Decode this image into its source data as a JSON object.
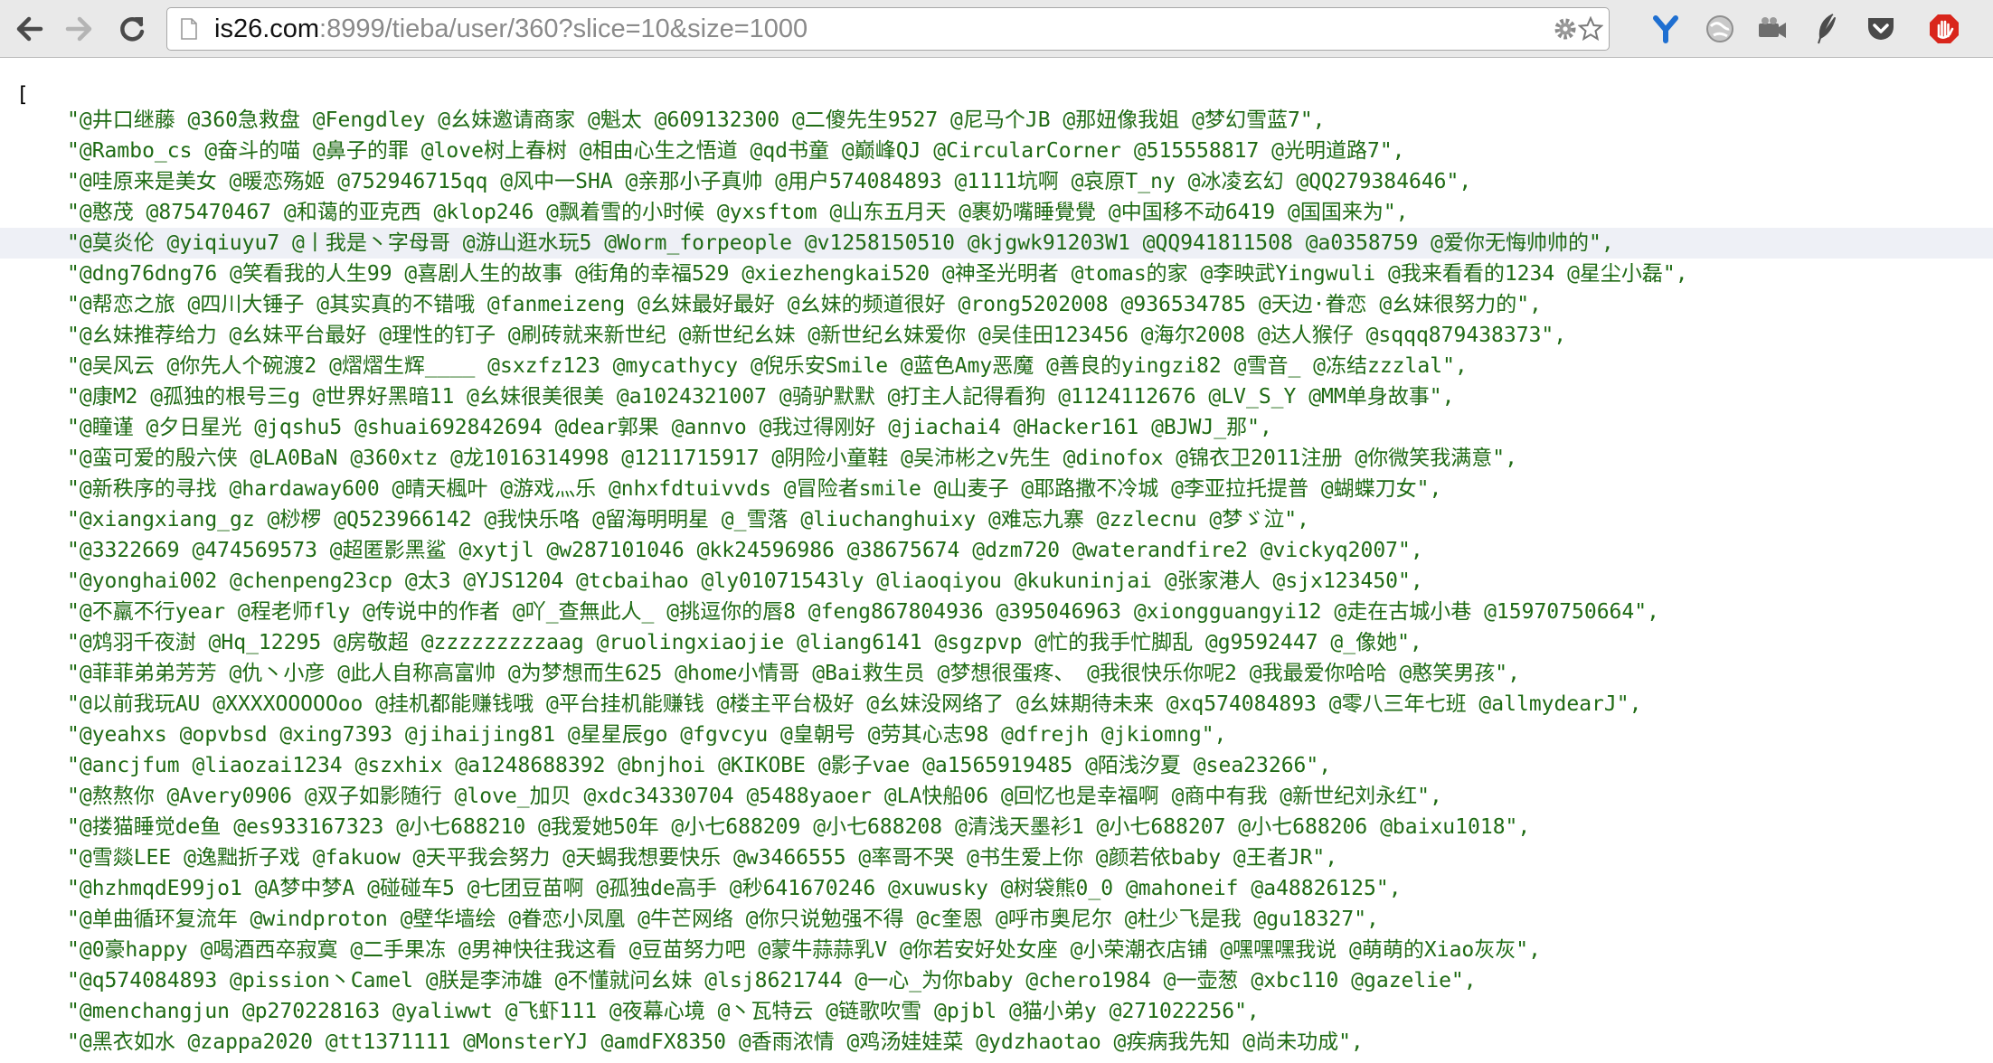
{
  "browser": {
    "url_host": "is26.com",
    "url_rest": ":8999/tieba/user/360?slice=10&size=1000",
    "colors": {
      "toolbar": "#e9e9e9",
      "text_green": "#1f6b14",
      "highlight": "#eef0f6"
    },
    "icons": [
      "back-arrow-icon",
      "forward-arrow-icon",
      "reload-icon",
      "page-icon",
      "settings-gear-icon",
      "bookmark-star-icon",
      "extension-y-icon",
      "extension-globe-icon",
      "extension-camera-icon",
      "extension-feather-icon",
      "pocket-icon",
      "block-hand-icon"
    ]
  },
  "content": {
    "open_bracket": "[",
    "highlight_row": 4,
    "lines": [
      "\"@井口继藤 @360急救盘 @Fengdley @幺妹邀请商家 @魁太 @609132300 @二傻先生9527 @尼马个JB @那妞像我姐 @梦幻雪蓝7\",",
      "\"@Rambo_cs @奋斗的喵 @鼻子的罪 @love树上春树 @相由心生之悟道 @qd书童 @巅峰QJ @CircularCorner @515558817 @光明道路7\",",
      "\"@哇原来是美女 @暖恋殇姬 @752946715qq @风中一SHA @亲那小子真帅 @用户574084893 @1111坑啊 @哀原T_ny @冰凌玄幻 @QQ279384646\",",
      "\"@憨茂 @875470467 @和蔼的亚克西 @klop246 @飘着雪的小时候 @yxsftom @山东五月天 @裹奶嘴睡覺覺 @中国移不动6419 @国国来为\",",
      "\"@莫炎伦 @yiqiuyu7 @丨我是丶字母哥 @游山逛水玩5 @Worm_forpeople @v1258150510 @kjgwk91203W1 @QQ941811508 @a0358759 @爱你无悔帅帅的\",",
      "\"@dng76dng76 @笑看我的人生99 @喜剧人生的故事 @街角的幸福529 @xiezhengkai520 @神圣光明者 @tomas的家 @李映武Yingwuli @我来看看的1234 @星尘小磊\",",
      "\"@帮恋之旅 @四川大锤子 @其实真的不错哦 @fanmeizeng @幺妹最好最好 @幺妹的频道很好 @rong5202008 @936534785 @天边·眷恋 @幺妹很努力的\",",
      "\"@幺妹推荐给力 @幺妹平台最好 @理性的钉子 @刷砖就来新世纪 @新世纪幺妹 @新世纪幺妹爱你 @吴佳田123456 @海尔2008 @达人猴仔 @sqqq879438373\",",
      "\"@吴风云 @你先人个碗渡2 @熠熠生辉____ @sxzfz123 @mycathycy @倪乐安Smile @蓝色Amy恶魔 @善良的yingzi82 @雪音_ @冻结zzzlal\",",
      "\"@康M2 @孤独的根号三g @世界好黑暗11 @幺妹很美很美 @a1024321007 @骑驴默默 @打主人記得看狗 @1124112676 @LV_S_Y @MM单身故事\",",
      "\"@瞳谨 @夕日星光 @jqshu5 @shuai692842694 @dear郭果 @annvo @我过得刚好 @jiachai4 @Hacker161 @BJWJ_那\",",
      "\"@蛮可爱的殷六侠 @LA0BaN @360xtz @龙1016314998 @1211715917 @阴险小童鞋 @吴沛彬之v先生 @dinofox @锦衣卫2011注册 @你微笑我满意\",",
      "\"@新秩序的寻找 @hardaway600 @晴天楓叶 @游戏灬乐 @nhxfdtuivvds @冒险者smile @山麦子 @耶路撒不冷城 @李亚拉托提普 @蝴蝶刀女\",",
      "\"@xiangxiang_gz @桫椤 @Q523966142 @我快乐咯 @留海明明星 @_雪落 @liuchanghuixy @难忘九寨 @zzlecnu @梦ゞ泣\",",
      "\"@3322669 @474569573 @超匿影黑鲨 @xytjl @w287101046 @kk24596986 @38675674 @dzm720 @waterandfire2 @vickyq2007\",",
      "\"@yonghai002 @chenpeng23cp @太3 @YJS1204 @tcbaihao @ly01071543ly @liaoqiyou @kukuninjai @张家港人 @sjx123450\",",
      "\"@不羸不行year @程老师fly @传说中的作者 @吖_查無此人_ @挑逗你的唇8 @feng867804936 @395046963 @xiongguangyi12 @走在古城小巷 @15970750664\",",
      "\"@鸩羽千夜澍 @Hq_12295 @房敬超 @zzzzzzzzzaag @ruolingxiaojie @liang6141 @sgzpvp @忙的我手忙脚乱 @g9592447 @_像她\",",
      "\"@菲菲弟弟芳芳 @仇丶小彦 @此人自称高富帅 @为梦想而生625 @home小情哥 @Bai救生员 @梦想很蛋疼、 @我很快乐你呢2 @我最爱你哈哈 @憨笑男孩\",",
      "\"@以前我玩AU @XXXXOOOOOoo @挂机都能赚钱哦 @平台挂机能赚钱 @楼主平台极好 @幺妹没网络了 @幺妹期待未来 @xq574084893 @零八三年七班 @allmydearJ\",",
      "\"@yeahxs @opvbsd @xing7393 @jihaijing81 @星星辰go @fgvcyu @皇朝号 @劳其心志98 @dfrejh @jkiomng\",",
      "\"@ancjfum @liaozai1234 @szxhix @a1248688392 @bnjhoi @KIKOBE @影子vae @a1565919485 @陌浅汐夏 @sea23266\",",
      "\"@熬熬你 @Avery0906 @双子如影随行 @love_加贝 @xdc34330704 @5488yaoer @LA快船06 @回忆也是幸福啊 @商中有我 @新世纪刘永红\",",
      "\"@搂猫睡觉de鱼 @es933167323 @小七688210 @我爱她50年 @小七688209 @小七688208 @清浅天墨衫1 @小七688207 @小七688206 @baixu1018\",",
      "\"@雪燚LEE @逸黜折子戏 @fakuow @天平我会努力 @天蝎我想要快乐 @w3466555 @率哥不哭 @书生爱上你 @颜若依baby @王者JR\",",
      "\"@hzhmqdE99jo1 @A梦中梦A @碰碰车5 @七团豆苗啊 @孤独de高手 @秒641670246 @xuwusky @树袋熊0_0 @mahoneif @a48826125\",",
      "\"@单曲循环复流年 @windproton @壁华墙绘 @眷恋小凤凰 @牛芒网络 @你只说勉强不得 @c奎恩 @呼市奥尼尔 @杜少飞是我 @gu18327\",",
      "\"@0豪happy @喝酒西卒寂寞 @二手果冻 @男神快往我这看 @豆苗努力吧 @蒙牛蒜蒜乳V @你若安好处女座 @小荣潮衣店铺 @嘿嘿嘿我说 @萌萌的Xiao灰灰\",",
      "\"@q574084893 @pission丶Camel @朕是李沛雄 @不懂就问幺妹 @lsj8621744 @一心_为你baby @chero1984 @一壶葱 @xbc110 @gazelie\",",
      "\"@menchangjun @p270228163 @yaliwwt @飞虾111 @夜幕心境 @丶瓦特云 @链歌吹雪 @pjbl @猫小弟y @271022256\",",
      "\"@黑衣如水 @zappa2020 @tt1371111 @MonsterYJ @amdFX8350 @香雨浓情 @鸡汤娃娃菜 @ydzhaotao @疾病我先知 @尚未功成\","
    ]
  }
}
